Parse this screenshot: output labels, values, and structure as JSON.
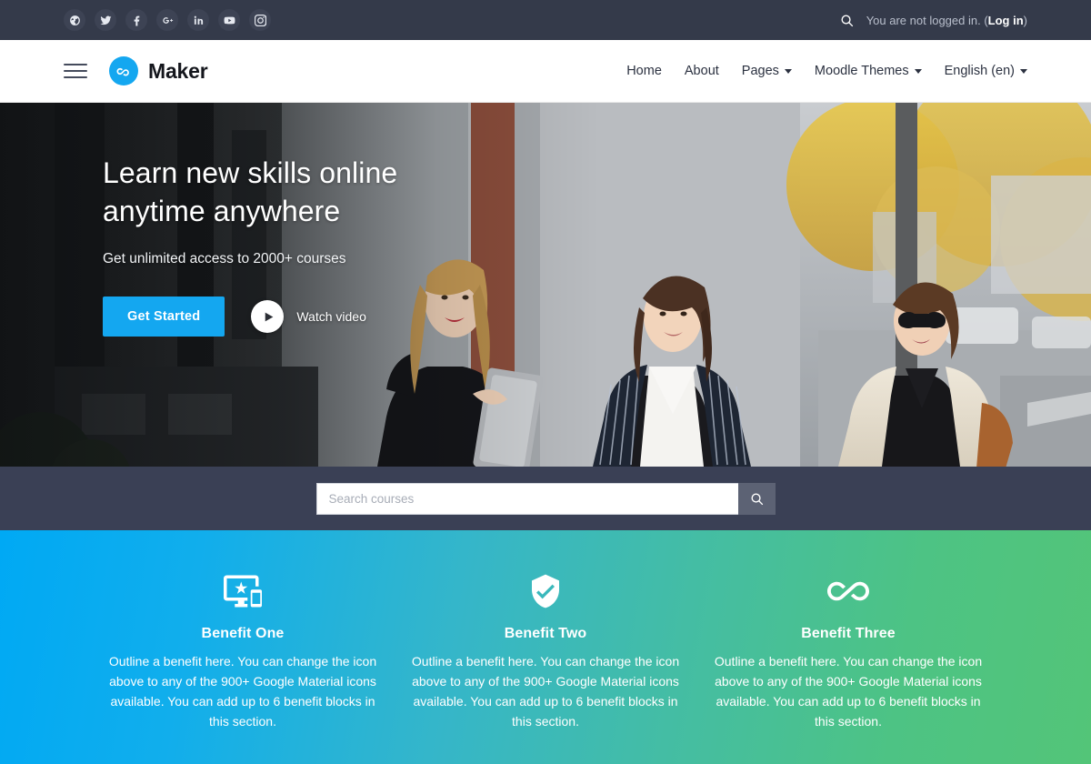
{
  "topbar": {
    "social": [
      {
        "name": "website-icon",
        "label": "Website"
      },
      {
        "name": "twitter-icon",
        "label": "Twitter"
      },
      {
        "name": "facebook-icon",
        "label": "Facebook"
      },
      {
        "name": "google-plus-icon",
        "label": "Google Plus"
      },
      {
        "name": "linkedin-icon",
        "label": "LinkedIn"
      },
      {
        "name": "youtube-icon",
        "label": "YouTube"
      },
      {
        "name": "instagram-icon",
        "label": "Instagram"
      }
    ],
    "search_icon": "search-icon",
    "login_prefix": "You are not logged in. (",
    "login_link": "Log in",
    "login_suffix": ")"
  },
  "header": {
    "menu_icon": "hamburger-icon",
    "logo_icon": "infinity-icon",
    "brand": "Maker",
    "nav": [
      {
        "label": "Home",
        "caret": false
      },
      {
        "label": "About",
        "caret": false
      },
      {
        "label": "Pages",
        "caret": true
      },
      {
        "label": "Moodle Themes",
        "caret": true
      },
      {
        "label": "English (en)",
        "caret": true
      }
    ]
  },
  "hero": {
    "title_line1": "Learn new skills online",
    "title_line2": "anytime anywhere",
    "subtitle": "Get unlimited access to 2000+ courses",
    "cta_label": "Get Started",
    "video_label": "Watch video",
    "play_icon": "play-icon"
  },
  "search": {
    "placeholder": "Search courses",
    "button_icon": "search-icon"
  },
  "benefits": [
    {
      "icon": "important-devices-icon",
      "title": "Benefit One",
      "text": "Outline a benefit here. You can change the icon above to any of the 900+ Google Material icons available. You can add up to 6 benefit blocks in this section."
    },
    {
      "icon": "verified-user-shield-icon",
      "title": "Benefit Two",
      "text": "Outline a benefit here. You can change the icon above to any of the 900+ Google Material icons available. You can add up to 6 benefit blocks in this section."
    },
    {
      "icon": "all-inclusive-infinity-icon",
      "title": "Benefit Three",
      "text": "Outline a benefit here. You can change the icon above to any of the 900+ Google Material icons available. You can add up to 6 benefit blocks in this section."
    }
  ],
  "colors": {
    "topbar_bg": "#343a4a",
    "accent_blue": "#14a7f0",
    "search_band_bg": "#3a4055",
    "gradient_start": "#00a9f4",
    "gradient_end": "#53c578"
  }
}
